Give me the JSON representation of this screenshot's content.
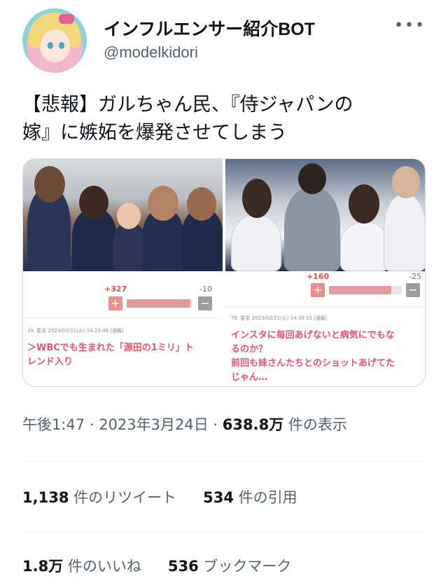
{
  "account": {
    "name": "インフルエンサー紹介BOT",
    "handle": "@modelkidori",
    "more_icon": "more-horizontal-icon"
  },
  "tweet": {
    "line1": "【悲報】ガルちゃん民、『侍ジャパンの",
    "line2": "嫁』に嫉妬を爆発させてしまう"
  },
  "media": {
    "left": {
      "plus_count": "+327",
      "minus_count": "-10",
      "plus_fraction": 0.97,
      "comment_meta": "39. 匿名 2023/03/21(火) 14:22:49 [通報]",
      "comment_line1": "＞WBCでも生まれた「源田の1ミリ」ト",
      "comment_line2": "レンド入り"
    },
    "right": {
      "plus_count": "+160",
      "minus_count": "-25",
      "plus_fraction": 0.86,
      "comment_meta": "78. 匿名 2023/03/21(火) 14:30:15 [通報]",
      "comment_line1": "インスタに毎回あげないと病気にでもな",
      "comment_line2": "るのか？",
      "comment_line3": "前回も妹さんたちとのショットあげてた",
      "comment_line4": "じゃん…"
    },
    "plus_symbol": "+",
    "minus_symbol": "−"
  },
  "meta": {
    "time": "午後1:47",
    "sep1": " · ",
    "date": "2023年3月24日",
    "sep2": " · ",
    "views": "638.8万",
    "views_label": " 件の表示"
  },
  "stats": {
    "retweets": "1,138",
    "retweets_label": " 件のリツイート",
    "quotes": "534",
    "quotes_label": " 件の引用",
    "likes": "1.8万",
    "likes_label": " 件のいいね",
    "bookmarks": "536",
    "bookmarks_label": " ブックマーク"
  },
  "colors": {
    "text": "#0f1419",
    "muted": "#536471",
    "vote_plus": "#e98d8d",
    "comment_text": "#e3556e"
  }
}
